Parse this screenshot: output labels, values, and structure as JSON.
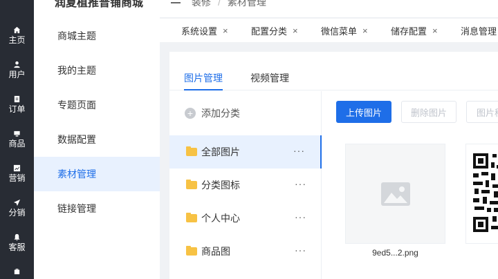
{
  "leftnav": {
    "items": [
      {
        "label": "主页",
        "icon": "home-icon"
      },
      {
        "label": "用户",
        "icon": "user-icon"
      },
      {
        "label": "订单",
        "icon": "order-icon"
      },
      {
        "label": "商品",
        "icon": "product-icon"
      },
      {
        "label": "营销",
        "icon": "marketing-icon"
      },
      {
        "label": "分销",
        "icon": "distribution-icon"
      },
      {
        "label": "客服",
        "icon": "service-icon"
      }
    ]
  },
  "submenu": {
    "title": "润夏植推普铺商城",
    "items": [
      {
        "label": "商城主题"
      },
      {
        "label": "我的主题"
      },
      {
        "label": "专题页面"
      },
      {
        "label": "数据配置"
      },
      {
        "label": "素材管理"
      },
      {
        "label": "链接管理"
      }
    ]
  },
  "header": {
    "breadcrumb": [
      "装修",
      "素材管理"
    ]
  },
  "tagsbar": {
    "tags": [
      {
        "label": "系统设置"
      },
      {
        "label": "配置分类"
      },
      {
        "label": "微信菜单"
      },
      {
        "label": "储存配置"
      },
      {
        "label": "消息管理"
      }
    ],
    "close_glyph": "×"
  },
  "content": {
    "tabs": [
      {
        "label": "图片管理"
      },
      {
        "label": "视频管理"
      }
    ],
    "add_category": "添加分类",
    "categories": [
      {
        "label": "全部图片"
      },
      {
        "label": "分类图标"
      },
      {
        "label": "个人中心"
      },
      {
        "label": "商品图"
      }
    ],
    "more_glyph": "···",
    "buttons": {
      "upload": "上传图片",
      "delete": "删除图片",
      "move": "图片移动"
    },
    "images": [
      {
        "name": "9ed5...2.png"
      }
    ]
  },
  "colors": {
    "primary": "#1e6ee8",
    "nav_bg": "#282c34",
    "active_bg": "#e8f1fe"
  }
}
